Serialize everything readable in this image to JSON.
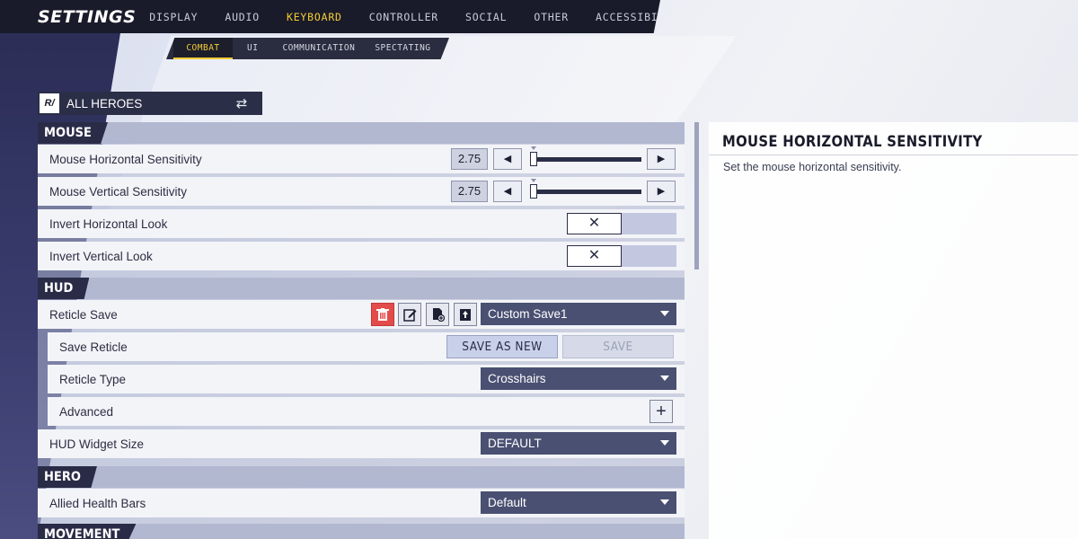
{
  "header": {
    "title": "SETTINGS",
    "tabs": [
      {
        "label": "DISPLAY",
        "active": false
      },
      {
        "label": "AUDIO",
        "active": false
      },
      {
        "label": "KEYBOARD",
        "active": true
      },
      {
        "label": "CONTROLLER",
        "active": false
      },
      {
        "label": "SOCIAL",
        "active": false
      },
      {
        "label": "OTHER",
        "active": false
      },
      {
        "label": "ACCESSIBILITY",
        "active": false
      }
    ],
    "subtabs": [
      {
        "label": "COMBAT",
        "active": true
      },
      {
        "label": "UI",
        "active": false
      },
      {
        "label": "COMMUNICATION",
        "active": false
      },
      {
        "label": "SPECTATING",
        "active": false
      }
    ]
  },
  "hero_selector": {
    "logo_text": "R/",
    "label": "ALL HEROES"
  },
  "sections": {
    "mouse": "MOUSE",
    "hud": "HUD",
    "hero": "HERO",
    "movement": "MOVEMENT"
  },
  "mouse": {
    "horizontal_sensitivity": {
      "label": "Mouse Horizontal Sensitivity",
      "value": "2.75",
      "fraction": 0.03
    },
    "vertical_sensitivity": {
      "label": "Mouse Vertical Sensitivity",
      "value": "2.75",
      "fraction": 0.03
    },
    "invert_horizontal": {
      "label": "Invert Horizontal Look",
      "state": "✕"
    },
    "invert_vertical": {
      "label": "Invert Vertical Look",
      "state": "✕"
    }
  },
  "hud": {
    "reticle_save": {
      "label": "Reticle Save",
      "value": "Custom Save1"
    },
    "save_reticle": {
      "label": "Save Reticle",
      "save_as_new": "SAVE AS NEW",
      "save": "SAVE"
    },
    "reticle_type": {
      "label": "Reticle Type",
      "value": "Crosshairs"
    },
    "advanced": {
      "label": "Advanced",
      "plus": "+"
    },
    "widget_size": {
      "label": "HUD Widget Size",
      "value": "DEFAULT"
    }
  },
  "hero": {
    "allied_health_bars": {
      "label": "Allied Health Bars",
      "value": "Default"
    }
  },
  "arrows": {
    "left": "◀",
    "right": "▶"
  },
  "description": {
    "title": "MOUSE HORIZONTAL SENSITIVITY",
    "text": "Set the mouse horizontal sensitivity."
  },
  "colors": {
    "accent": "#f3cc35",
    "dark": "#1a1b2a",
    "delete": "#e44b4b"
  }
}
